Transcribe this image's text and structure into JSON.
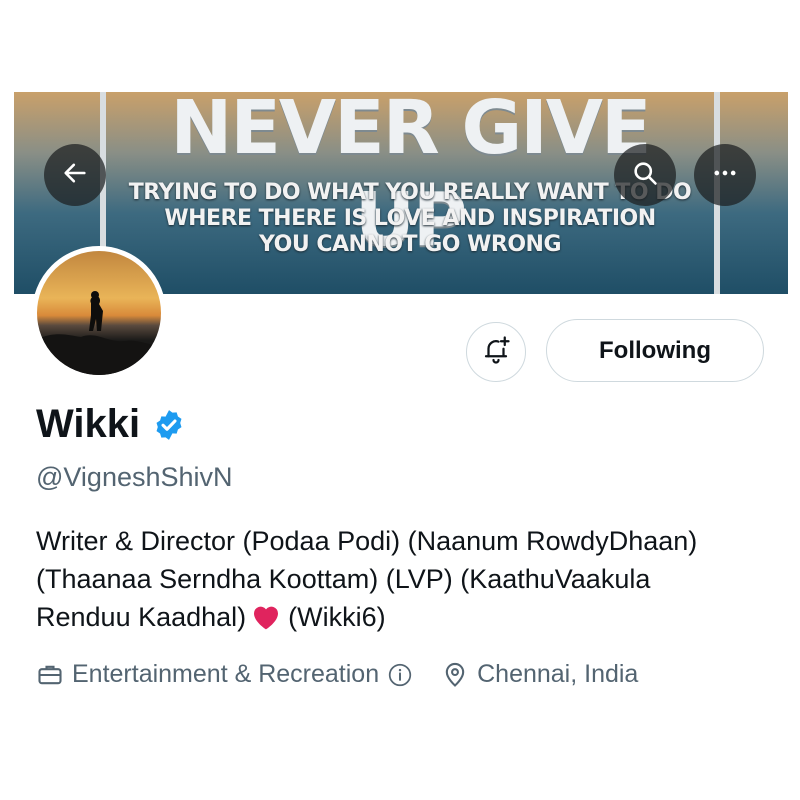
{
  "banner": {
    "headline": "NEVER GIVE UP",
    "lines": [
      "TRYING TO DO WHAT YOU REALLY WANT TO DO",
      "WHERE THERE IS LOVE AND INSPIRATION",
      "YOU CANNOT GO WRONG"
    ]
  },
  "header_actions": {
    "back_icon": "arrow-left-icon",
    "search_icon": "search-icon",
    "more_icon": "more-horizontal-icon"
  },
  "profile": {
    "name": "Wikki",
    "verified": true,
    "handle": "@VigneshShivN",
    "bio_lines": [
      "Writer & Director (Podaa Podi) (Naanum RowdyDhaan)",
      "(Thaanaa Serndha Koottam) (LVP) (KaathuVaakula",
      "Renduu Kaadhal)"
    ],
    "bio_tail": "(Wikki6)",
    "category": "Entertainment & Recreation",
    "location": "Chennai, India"
  },
  "actions": {
    "notify_icon": "bell-plus-icon",
    "follow_label": "Following"
  },
  "colors": {
    "verified_blue": "#1d9bf0",
    "secondary_text": "#536471",
    "heart_red": "#e0245e"
  }
}
